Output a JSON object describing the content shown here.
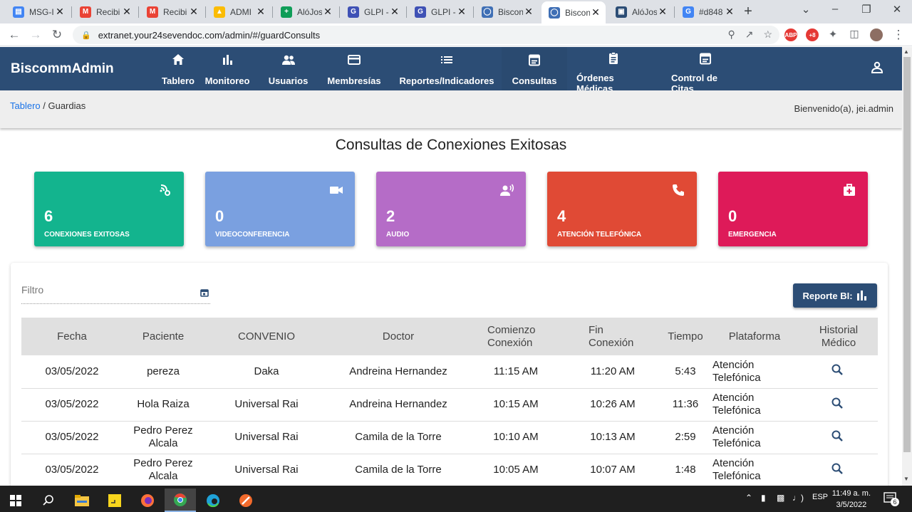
{
  "browser": {
    "tabs": [
      {
        "title": "MSG-I",
        "icon": "docs-icon",
        "color": "#4285f4"
      },
      {
        "title": "Recibi",
        "icon": "gmail-icon",
        "color": "#ea4335"
      },
      {
        "title": "Recibi",
        "icon": "gmail-icon",
        "color": "#ea4335"
      },
      {
        "title": "ADMI",
        "icon": "drive-icon",
        "color": "#fbbc04"
      },
      {
        "title": "AlóJos",
        "icon": "sheets-icon",
        "color": "#0f9d58"
      },
      {
        "title": "GLPI -",
        "icon": "glpi-icon",
        "color": "#3f51b5"
      },
      {
        "title": "GLPI -",
        "icon": "glpi-icon",
        "color": "#3f51b5"
      },
      {
        "title": "Biscon",
        "icon": "biscomm-icon",
        "color": "#3f6fb5"
      },
      {
        "title": "Biscon",
        "icon": "biscomm-icon",
        "color": "#3f6fb5"
      },
      {
        "title": "AlóJos",
        "icon": "app-icon",
        "color": "#2c4d75"
      },
      {
        "title": "#d848",
        "icon": "google-icon",
        "color": "#4285f4"
      }
    ],
    "url": "extranet.your24sevendoc.com/admin/#/guardConsults"
  },
  "header": {
    "brand": "BiscommAdmin",
    "nav": [
      {
        "label": "Tablero",
        "icon": "home-icon"
      },
      {
        "label": "Monitoreo",
        "icon": "bar-chart-icon"
      },
      {
        "label": "Usuarios",
        "icon": "users-icon"
      },
      {
        "label": "Membresías",
        "icon": "credit-card-icon"
      },
      {
        "label": "Reportes/Indicadores",
        "icon": "list-icon"
      },
      {
        "label": "Consultas",
        "icon": "calendar-icon"
      },
      {
        "label": "Órdenes Médicas",
        "icon": "clipboard-icon"
      },
      {
        "label": "Control de Citas",
        "icon": "calendar-icon"
      }
    ]
  },
  "breadcrumb": {
    "root": "Tablero",
    "separator": " / ",
    "current": "Guardias"
  },
  "welcome": "Bienvenido(a), jei.admin",
  "page_title": "Consultas de Conexiones Exitosas",
  "cards": [
    {
      "value": "6",
      "label": "CONEXIONES EXITOSAS",
      "color": "#13b48e",
      "icon": "connection-icon"
    },
    {
      "value": "0",
      "label": "VIDEOCONFERENCIA",
      "color": "#7aa0e0",
      "icon": "video-icon"
    },
    {
      "value": "2",
      "label": "AUDIO",
      "color": "#b56cc7",
      "icon": "voice-icon"
    },
    {
      "value": "4",
      "label": "ATENCIÓN TELEFÓNICA",
      "color": "#e04a35",
      "icon": "phone-icon"
    },
    {
      "value": "0",
      "label": "EMERGENCIA",
      "color": "#de1a59",
      "icon": "medkit-icon"
    }
  ],
  "filter": {
    "placeholder": "Filtro"
  },
  "report_button": "Reporte BI:",
  "table": {
    "headers": [
      "Fecha",
      "Paciente",
      "CONVENIO",
      "Doctor",
      "Comienzo\nConexión",
      "Fin\nConexión",
      "Tiempo",
      "Plataforma",
      "Historial\nMédico"
    ],
    "rows": [
      [
        "03/05/2022",
        "pereza",
        "Daka",
        "Andreina Hernandez",
        "11:15 AM",
        "11:20 AM",
        "5:43",
        "Atención\nTelefónica"
      ],
      [
        "03/05/2022",
        "Hola Raiza",
        "Universal Rai",
        "Andreina Hernandez",
        "10:15 AM",
        "10:26 AM",
        "11:36",
        "Atención\nTelefónica"
      ],
      [
        "03/05/2022",
        "Pedro Perez Alcala",
        "Universal Rai",
        "Camila de la Torre",
        "10:10 AM",
        "10:13 AM",
        "2:59",
        "Atención\nTelefónica"
      ],
      [
        "03/05/2022",
        "Pedro Perez Alcala",
        "Universal Rai",
        "Camila de la Torre",
        "10:05 AM",
        "10:07 AM",
        "1:48",
        "Atención\nTelefónica"
      ]
    ]
  },
  "taskbar": {
    "lang": "ESP",
    "time": "11:49 a. m.",
    "date": "3/5/2022",
    "notifications": "6"
  }
}
